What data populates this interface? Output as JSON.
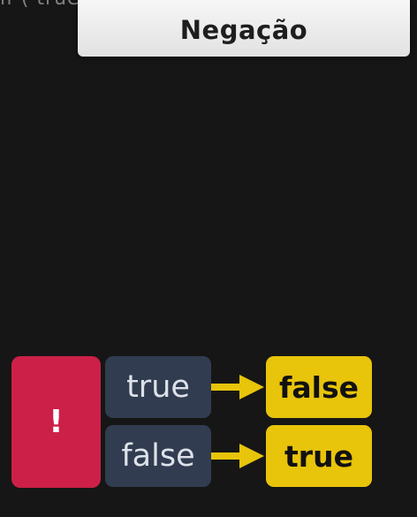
{
  "slide": {
    "title": "Negação",
    "operator_symbol": "!"
  },
  "rows": [
    {
      "input": "true",
      "output": "false"
    },
    {
      "input": "false",
      "output": "true"
    }
  ],
  "colors": {
    "background": "#161616",
    "operator": "#cc2048",
    "input": "#323c50",
    "output": "#e8c40a",
    "arrow": "#e8c40a"
  }
}
